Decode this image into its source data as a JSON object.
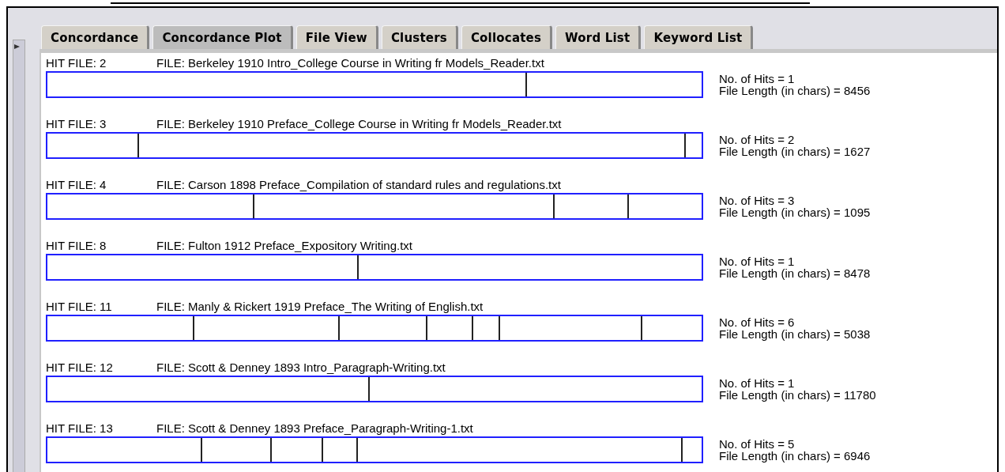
{
  "tabs": [
    {
      "label": "Concordance",
      "selected": false
    },
    {
      "label": "Concordance Plot",
      "selected": true
    },
    {
      "label": "File View",
      "selected": false
    },
    {
      "label": "Clusters",
      "selected": false
    },
    {
      "label": "Collocates",
      "selected": false
    },
    {
      "label": "Word List",
      "selected": false
    },
    {
      "label": "Keyword List",
      "selected": false
    }
  ],
  "plots": [
    {
      "hit_file": "HIT FILE: 2",
      "file": "FILE: Berkeley 1910 Intro_College Course in Writing fr Models_Reader.txt",
      "hits_text": "No. of Hits = 1",
      "length_text": "File Length (in chars) = 8456",
      "hits": [
        {
          "level": 0.731
        }
      ]
    },
    {
      "hit_file": "HIT FILE: 3",
      "file": "FILE: Berkeley 1910 Preface_College Course in Writing fr Models_Reader.txt",
      "hits_text": "No. of Hits = 2",
      "length_text": "File Length (in chars) = 1627",
      "hits": [
        {
          "level": 0.138
        },
        {
          "level": 0.974
        }
      ]
    },
    {
      "hit_file": "HIT FILE: 4",
      "file": "FILE: Carson 1898 Preface_Compilation of standard rules and regulations.txt",
      "hits_text": "No. of Hits = 3",
      "length_text": "File Length (in chars) = 1095",
      "hits": [
        {
          "level": 0.314
        },
        {
          "level": 0.773
        },
        {
          "level": 0.886
        }
      ]
    },
    {
      "hit_file": "HIT FILE: 8",
      "file": "FILE: Fulton 1912 Preface_Expository Writing.txt",
      "hits_text": "No. of Hits = 1",
      "length_text": "File Length (in chars) = 8478",
      "hits": [
        {
          "level": 0.474
        }
      ]
    },
    {
      "hit_file": "HIT FILE: 11",
      "file": "FILE: Manly & Rickert 1919 Preface_The Writing of English.txt",
      "hits_text": "No. of Hits = 6",
      "length_text": "File Length (in chars) = 5038",
      "hits": [
        {
          "level": 0.222
        },
        {
          "level": 0.444
        },
        {
          "level": 0.578
        },
        {
          "level": 0.648
        },
        {
          "level": 0.69
        },
        {
          "level": 0.907
        }
      ]
    },
    {
      "hit_file": "HIT FILE: 12",
      "file": "FILE: Scott & Denney 1893 Intro_Paragraph-Writing.txt",
      "hits_text": "No. of Hits = 1",
      "length_text": "File Length (in chars) = 11780",
      "hits": [
        {
          "level": 0.49
        }
      ]
    },
    {
      "hit_file": "HIT FILE: 13",
      "file": "FILE: Scott & Denney 1893 Preface_Paragraph-Writing-1.txt",
      "hits_text": "No. of Hits = 5",
      "length_text": "File Length (in chars) = 6946",
      "hits": [
        {
          "level": 0.234
        },
        {
          "level": 0.34
        },
        {
          "level": 0.419
        },
        {
          "level": 0.472
        },
        {
          "level": 0.968
        }
      ]
    }
  ]
}
